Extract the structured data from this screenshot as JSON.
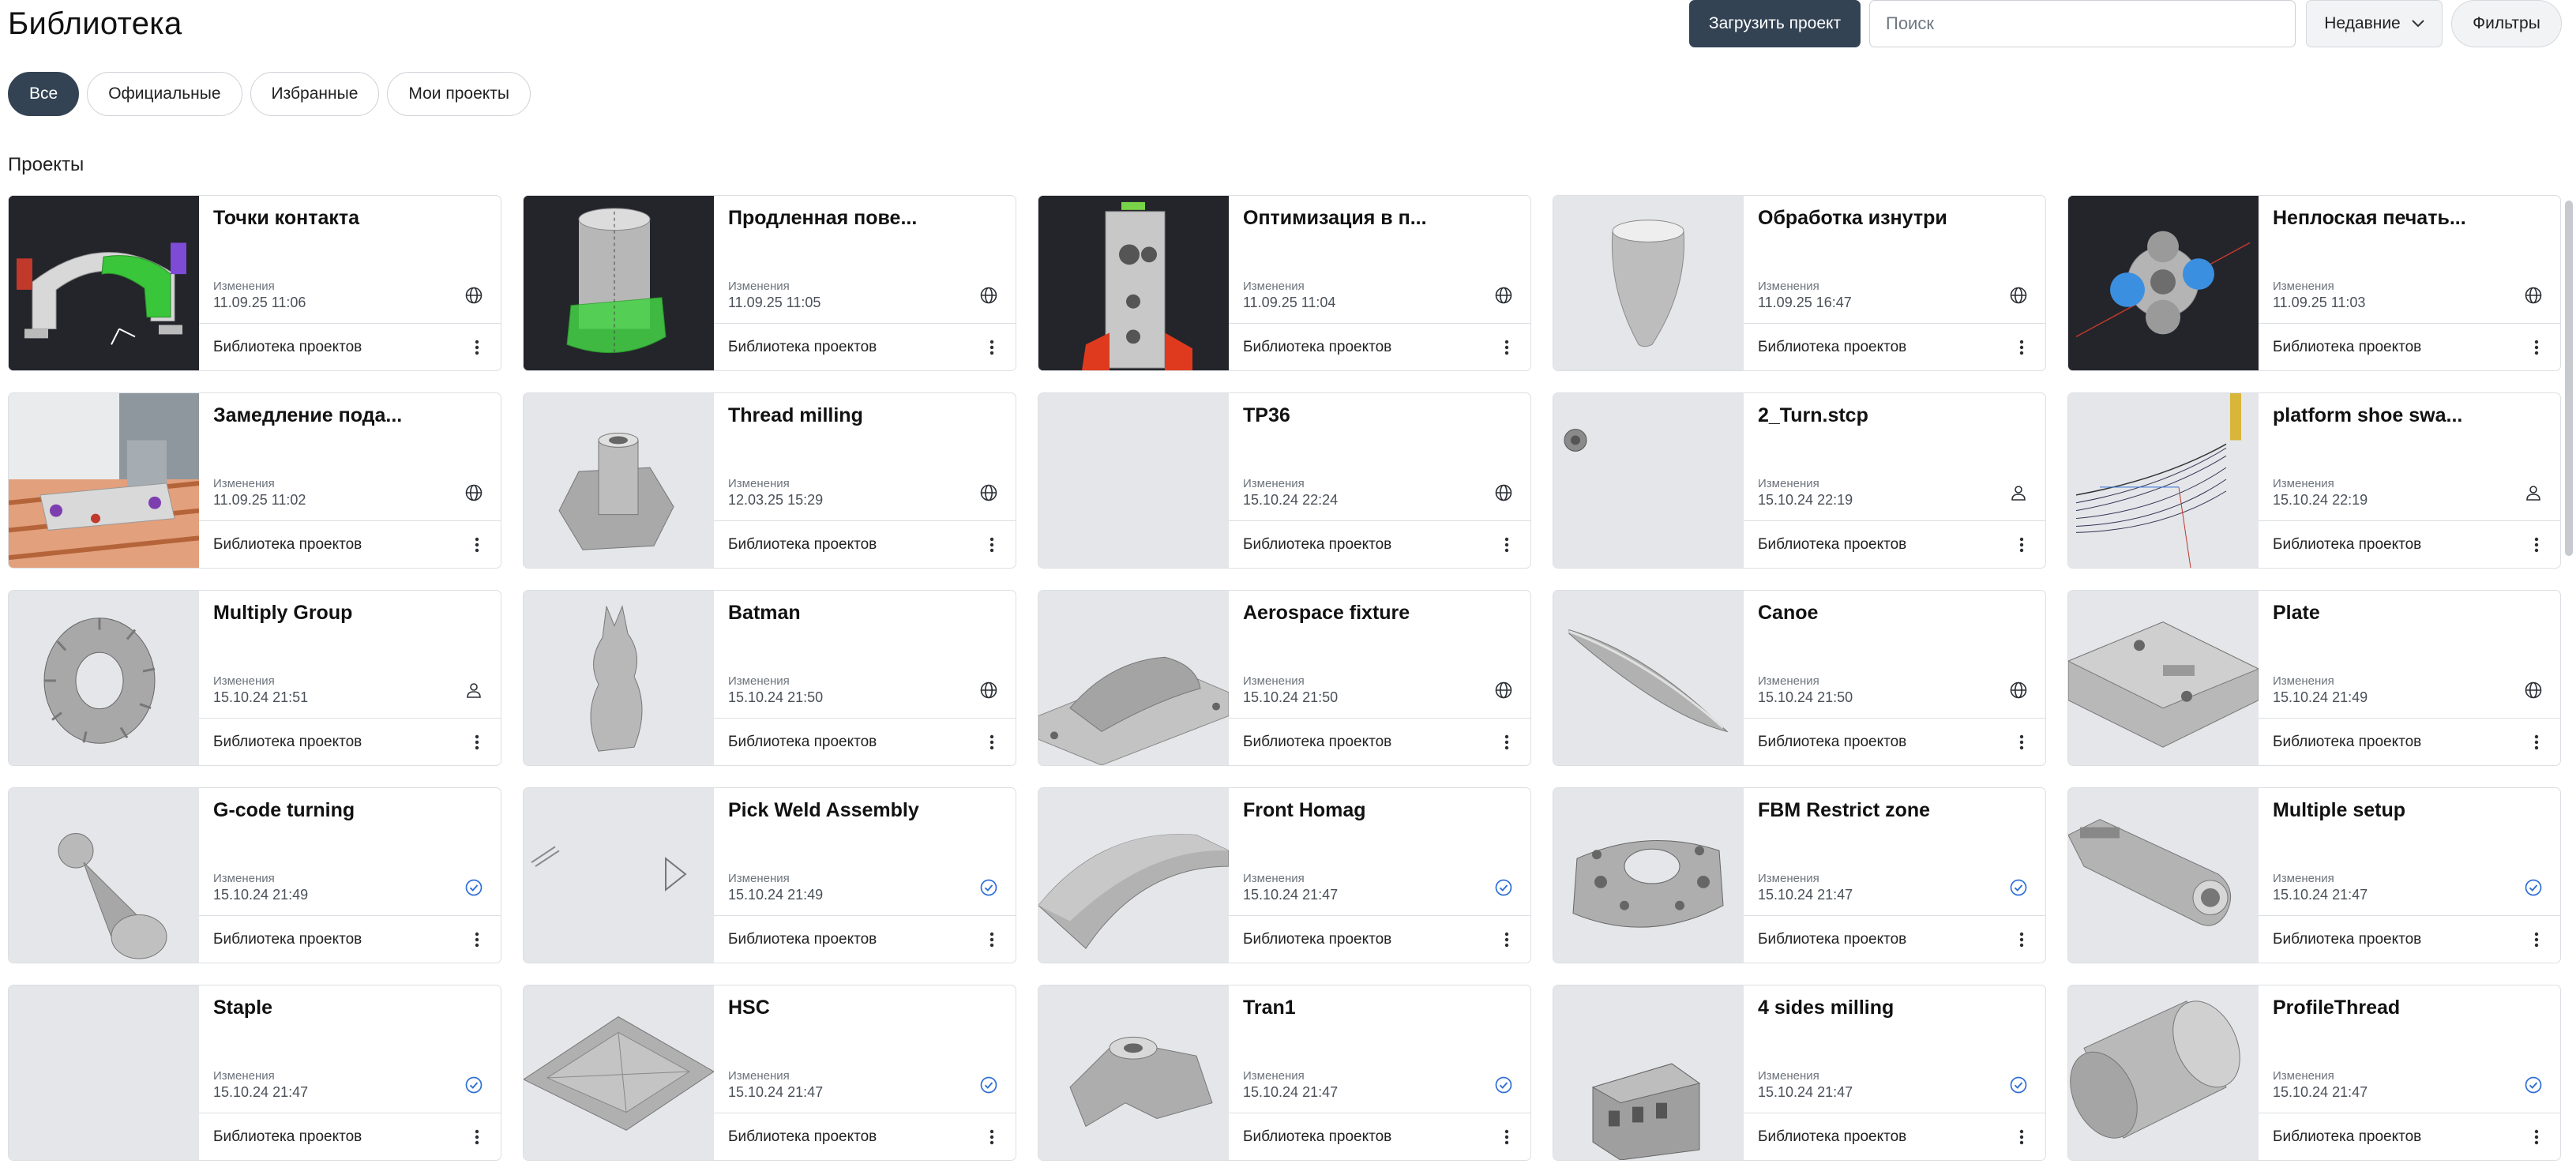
{
  "header": {
    "title": "Библиотека",
    "upload_label": "Загрузить проект",
    "search_placeholder": "Поиск",
    "sort_label": "Недавние",
    "filters_label": "Фильтры"
  },
  "tabs": [
    {
      "label": "Все",
      "active": true
    },
    {
      "label": "Официальные",
      "active": false
    },
    {
      "label": "Избранные",
      "active": false
    },
    {
      "label": "Мои проекты",
      "active": false
    }
  ],
  "section_title": "Проекты",
  "card_common": {
    "modified_label": "Изменения",
    "library_label": "Библиотека проектов"
  },
  "colors": {
    "primary": "#334354",
    "official": "#2f6fd6",
    "icon": "#2b2f34"
  },
  "projects": [
    {
      "title": "Точки контакта",
      "date": "11.09.25 11:06",
      "visibility": "globe-icon",
      "thumb": "arch-green"
    },
    {
      "title": "Продленная пове...",
      "date": "11.09.25 11:05",
      "visibility": "globe-icon",
      "thumb": "cylinder-green"
    },
    {
      "title": "Оптимизация в п...",
      "date": "11.09.25 11:04",
      "visibility": "globe-icon",
      "thumb": "block-holes"
    },
    {
      "title": "Обработка изнутри",
      "date": "11.09.25 16:47",
      "visibility": "globe-icon",
      "thumb": "cup"
    },
    {
      "title": "Неплоская печать...",
      "date": "11.09.25 11:03",
      "visibility": "globe-icon",
      "thumb": "pipe-fitting"
    },
    {
      "title": "Замедление пода...",
      "date": "11.09.25 11:02",
      "visibility": "globe-icon",
      "thumb": "machine-table"
    },
    {
      "title": "Thread milling",
      "date": "12.03.25 15:29",
      "visibility": "globe-icon",
      "thumb": "hex-boss"
    },
    {
      "title": "TP36",
      "date": "15.10.24 22:24",
      "visibility": "globe-icon",
      "thumb": "empty"
    },
    {
      "title": "2_Turn.stcp",
      "date": "15.10.24 22:19",
      "visibility": "user-icon",
      "thumb": "small-part"
    },
    {
      "title": "platform shoe swa...",
      "date": "15.10.24 22:19",
      "visibility": "user-icon",
      "thumb": "toolpath"
    },
    {
      "title": "Multiply Group",
      "date": "15.10.24 21:51",
      "visibility": "user-icon",
      "thumb": "gear"
    },
    {
      "title": "Batman",
      "date": "15.10.24 21:50",
      "visibility": "globe-icon",
      "thumb": "bust"
    },
    {
      "title": "Aerospace fixture",
      "date": "15.10.24 21:50",
      "visibility": "globe-icon",
      "thumb": "fixture"
    },
    {
      "title": "Canoe",
      "date": "15.10.24 21:50",
      "visibility": "globe-icon",
      "thumb": "canoe"
    },
    {
      "title": "Plate",
      "date": "15.10.24 21:49",
      "visibility": "globe-icon",
      "thumb": "plate"
    },
    {
      "title": "G-code turning",
      "date": "15.10.24 21:49",
      "visibility": "check-badge-icon",
      "thumb": "pawn"
    },
    {
      "title": "Pick Weld Assembly",
      "date": "15.10.24 21:49",
      "visibility": "check-badge-icon",
      "thumb": "weld"
    },
    {
      "title": "Front Homag",
      "date": "15.10.24 21:47",
      "visibility": "check-badge-icon",
      "thumb": "curved-sheet"
    },
    {
      "title": "FBM Restrict zone",
      "date": "15.10.24 21:47",
      "visibility": "check-badge-icon",
      "thumb": "housing"
    },
    {
      "title": "Multiple setup",
      "date": "15.10.24 21:47",
      "visibility": "check-badge-icon",
      "thumb": "arm"
    },
    {
      "title": "Staple",
      "date": "15.10.24 21:47",
      "visibility": "check-badge-icon",
      "thumb": "empty"
    },
    {
      "title": "HSC",
      "date": "15.10.24 21:47",
      "visibility": "check-badge-icon",
      "thumb": "flat-plate"
    },
    {
      "title": "Tran1",
      "date": "15.10.24 21:47",
      "visibility": "check-badge-icon",
      "thumb": "bracket"
    },
    {
      "title": "4 sides milling",
      "date": "15.10.24 21:47",
      "visibility": "check-badge-icon",
      "thumb": "box-part"
    },
    {
      "title": "ProfileThread",
      "date": "15.10.24 21:47",
      "visibility": "check-badge-icon",
      "thumb": "roll"
    }
  ]
}
